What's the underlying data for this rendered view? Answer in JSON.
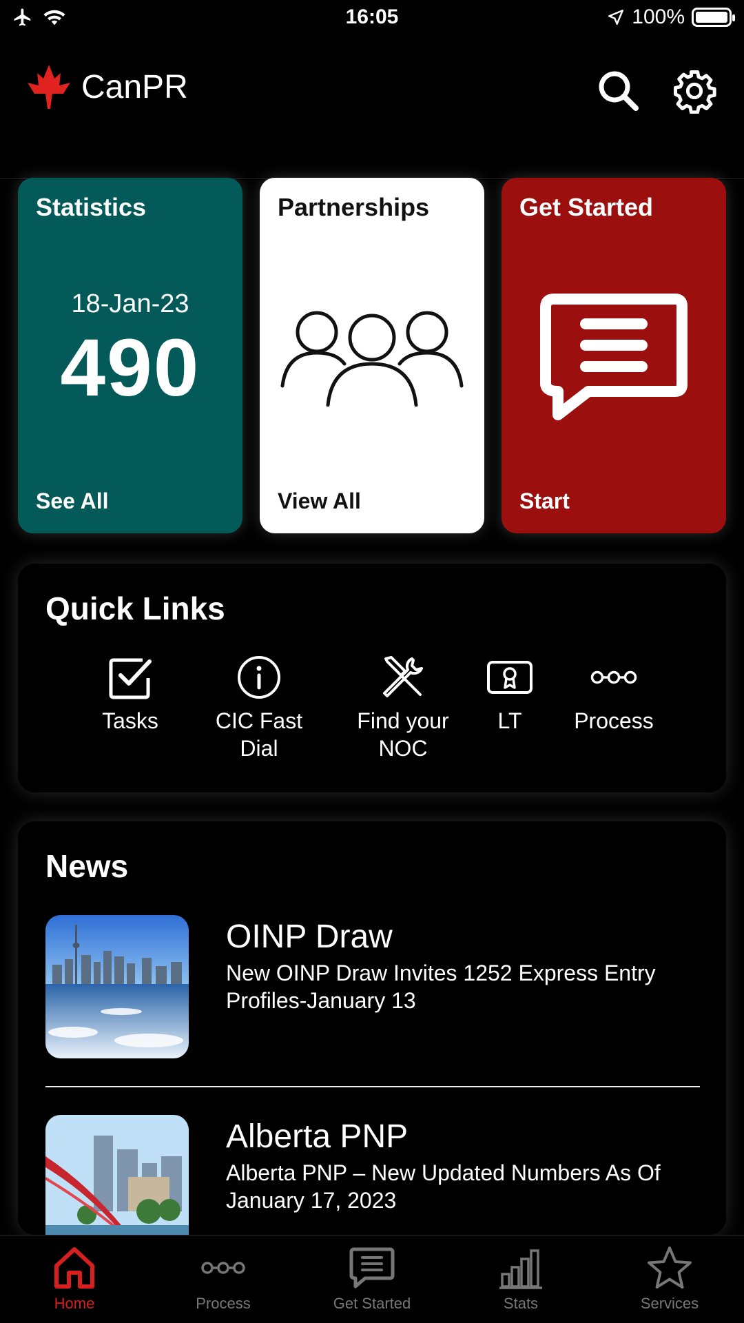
{
  "status_bar": {
    "time": "16:05",
    "battery": "100%"
  },
  "app": {
    "name": "CanPR"
  },
  "tiles": {
    "statistics": {
      "title": "Statistics",
      "date": "18-Jan-23",
      "value": "490",
      "footer": "See All"
    },
    "partnerships": {
      "title": "Partnerships",
      "footer": "View All"
    },
    "get_started": {
      "title": "Get Started",
      "footer": "Start"
    }
  },
  "quick_links": {
    "title": "Quick Links",
    "items": [
      {
        "label": "Tasks",
        "icon": "checkbox-icon"
      },
      {
        "label": "CIC Fast\nDial",
        "icon": "info-icon"
      },
      {
        "label": "Find your\nNOC",
        "icon": "tools-icon"
      },
      {
        "label": "LT",
        "icon": "certificate-icon"
      },
      {
        "label": "Process",
        "icon": "process-icon"
      }
    ]
  },
  "news": {
    "title": "News",
    "items": [
      {
        "title": "OINP Draw",
        "description": "New OINP Draw Invites 1252 Express Entry Profiles-January 13"
      },
      {
        "title": "Alberta PNP",
        "description": "Alberta PNP – New Updated Numbers As Of January 17, 2023"
      }
    ]
  },
  "tab_bar": {
    "active": "Home",
    "items": [
      {
        "label": "Home",
        "icon": "home-icon"
      },
      {
        "label": "Process",
        "icon": "process-icon"
      },
      {
        "label": "Get Started",
        "icon": "message-icon"
      },
      {
        "label": "Stats",
        "icon": "bar-chart-icon"
      },
      {
        "label": "Services",
        "icon": "star-icon"
      }
    ]
  },
  "colors": {
    "accent": "#d61f1f",
    "teal": "#035a59",
    "red_tile": "#9b0f0f"
  }
}
